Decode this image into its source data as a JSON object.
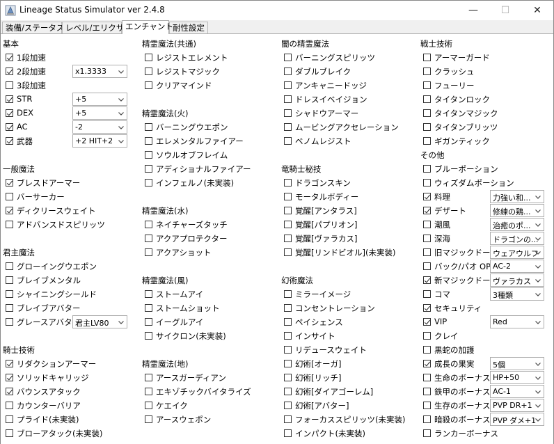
{
  "window": {
    "title": "Lineage Status Simulator ver 2.4.8",
    "minimize_glyph": "—",
    "maximize_glyph": "☐",
    "close_glyph": "✕"
  },
  "tabs": [
    {
      "label": "装備/ステータス",
      "active": false
    },
    {
      "label": "レベル/エリクサー",
      "active": false
    },
    {
      "label": "エンチャント",
      "active": true
    },
    {
      "label": "耐性設定",
      "active": false
    }
  ],
  "sections": [
    {
      "title": "基本",
      "items": [
        {
          "label": "1段加速",
          "checked": true,
          "select": null
        },
        {
          "label": "2段加速",
          "checked": true,
          "select": "x1.3333"
        },
        {
          "label": "3段加速",
          "checked": false,
          "select": null
        },
        {
          "label": "STR",
          "checked": true,
          "select": "+5"
        },
        {
          "label": "DEX",
          "checked": true,
          "select": "+5"
        },
        {
          "label": "AC",
          "checked": true,
          "select": "-2"
        },
        {
          "label": "武器",
          "checked": true,
          "select": "+2 HIT+2"
        }
      ]
    },
    {
      "title": "一般魔法",
      "items": [
        {
          "label": "ブレスドアーマー",
          "checked": true,
          "select": null
        },
        {
          "label": "バーサーカー",
          "checked": false,
          "select": null
        },
        {
          "label": "ディクリースウェイト",
          "checked": true,
          "select": null
        },
        {
          "label": "アドバンスドスピリッツ",
          "checked": false,
          "select": null
        }
      ]
    },
    {
      "title": "君主魔法",
      "items": [
        {
          "label": "グローイングウエポン",
          "checked": false,
          "select": null
        },
        {
          "label": "ブレイブメンタル",
          "checked": false,
          "select": null
        },
        {
          "label": "シャイニングシールド",
          "checked": false,
          "select": null
        },
        {
          "label": "ブレイブアバター",
          "checked": false,
          "select": null
        },
        {
          "label": "グレースアバター",
          "checked": false,
          "select": "君主LV80"
        }
      ]
    },
    {
      "title": "騎士技術",
      "items": [
        {
          "label": "リダクションアーマー",
          "checked": true,
          "select": null
        },
        {
          "label": "ソリッドキャリッジ",
          "checked": true,
          "select": null
        },
        {
          "label": "バウンスアタック",
          "checked": true,
          "select": null
        },
        {
          "label": "カウンターバリア",
          "checked": false,
          "select": null
        },
        {
          "label": "プライド(未実装)",
          "checked": false,
          "select": null
        },
        {
          "label": "ブローアタック(未実装)",
          "checked": false,
          "select": null
        }
      ]
    },
    {
      "title": "精霊魔法(共通)",
      "items": [
        {
          "label": "レジストエレメント",
          "checked": false,
          "select": null
        },
        {
          "label": "レジストマジック",
          "checked": false,
          "select": null
        },
        {
          "label": "クリアマインド",
          "checked": false,
          "select": null
        }
      ]
    },
    {
      "title": "精霊魔法(火)",
      "items": [
        {
          "label": "バーニングウエポン",
          "checked": false,
          "select": null
        },
        {
          "label": "エレメンタルファイアー",
          "checked": false,
          "select": null
        },
        {
          "label": "ソウルオブフレイム",
          "checked": false,
          "select": null
        },
        {
          "label": "アディショナルファイアー",
          "checked": false,
          "select": null
        },
        {
          "label": "インフェルノ(未実装)",
          "checked": false,
          "select": null
        }
      ]
    },
    {
      "title": "精霊魔法(水)",
      "items": [
        {
          "label": "ネイチャーズタッチ",
          "checked": false,
          "select": null
        },
        {
          "label": "アクアプロテクター",
          "checked": false,
          "select": null
        },
        {
          "label": "アクアショット",
          "checked": false,
          "select": null
        }
      ]
    },
    {
      "title": "精霊魔法(風)",
      "items": [
        {
          "label": "ストームアイ",
          "checked": false,
          "select": null
        },
        {
          "label": "ストームショット",
          "checked": false,
          "select": null
        },
        {
          "label": "イーグルアイ",
          "checked": false,
          "select": null
        },
        {
          "label": "サイクロン(未実装)",
          "checked": false,
          "select": null
        }
      ]
    },
    {
      "title": "精霊魔法(地)",
      "items": [
        {
          "label": "アースガーディアン",
          "checked": false,
          "select": null
        },
        {
          "label": "エキゾチックバイタライズ",
          "checked": false,
          "select": null
        },
        {
          "label": "ケエイク",
          "checked": false,
          "select": null
        },
        {
          "label": "アースウェポン",
          "checked": false,
          "select": null
        }
      ]
    },
    {
      "title": "闇の精霊魔法",
      "items": [
        {
          "label": "バーニングスピリッツ",
          "checked": false,
          "select": null
        },
        {
          "label": "ダブルブレイク",
          "checked": false,
          "select": null
        },
        {
          "label": "アンキャニードッジ",
          "checked": false,
          "select": null
        },
        {
          "label": "ドレスイベイジョン",
          "checked": false,
          "select": null
        },
        {
          "label": "シャドウアーマー",
          "checked": false,
          "select": null
        },
        {
          "label": "ムービングアクセレーション",
          "checked": false,
          "select": null
        },
        {
          "label": "ベノムレジスト",
          "checked": false,
          "select": null
        }
      ]
    },
    {
      "title": "竜騎士秘技",
      "items": [
        {
          "label": "ドラゴンスキン",
          "checked": false,
          "select": null
        },
        {
          "label": "モータルボディー",
          "checked": false,
          "select": null
        },
        {
          "label": "覚醒[アンタラス]",
          "checked": false,
          "select": null
        },
        {
          "label": "覚醒[パプリオン]",
          "checked": false,
          "select": null
        },
        {
          "label": "覚醒[ヴァラカス]",
          "checked": false,
          "select": null
        },
        {
          "label": "覚醒[リンドビオル](未実装)",
          "checked": false,
          "select": null
        }
      ]
    },
    {
      "title": "幻術魔法",
      "items": [
        {
          "label": "ミラーイメージ",
          "checked": false,
          "select": null
        },
        {
          "label": "コンセントレーション",
          "checked": false,
          "select": null
        },
        {
          "label": "ペイシェンス",
          "checked": false,
          "select": null
        },
        {
          "label": "インサイト",
          "checked": false,
          "select": null
        },
        {
          "label": "リデュースウェイト",
          "checked": false,
          "select": null
        },
        {
          "label": "幻術[オーガ]",
          "checked": false,
          "select": null
        },
        {
          "label": "幻術[リッチ]",
          "checked": false,
          "select": null
        },
        {
          "label": "幻術[ダイアゴーレム]",
          "checked": false,
          "select": null
        },
        {
          "label": "幻術[アバター]",
          "checked": false,
          "select": null
        },
        {
          "label": "フォーカススピリッツ(未実装)",
          "checked": false,
          "select": null
        },
        {
          "label": "インパクト(未実装)",
          "checked": false,
          "select": null
        }
      ]
    },
    {
      "title": "戦士技術",
      "items": [
        {
          "label": "アーマーガード",
          "checked": false,
          "select": null
        },
        {
          "label": "クラッシュ",
          "checked": false,
          "select": null
        },
        {
          "label": "フューリー",
          "checked": false,
          "select": null
        },
        {
          "label": "タイタンロック",
          "checked": false,
          "select": null
        },
        {
          "label": "タイタンマジック",
          "checked": false,
          "select": null
        },
        {
          "label": "タイタンブリッツ",
          "checked": false,
          "select": null
        },
        {
          "label": "ギガンティック",
          "checked": false,
          "select": null
        }
      ]
    },
    {
      "title": "その他",
      "items": [
        {
          "label": "ブルーポーション",
          "checked": false,
          "select": null
        },
        {
          "label": "ウィズダムポーション",
          "checked": false,
          "select": null
        },
        {
          "label": "料理",
          "checked": true,
          "select": "力強い和..."
        },
        {
          "label": "デザート",
          "checked": true,
          "select": "修練の鶏..."
        },
        {
          "label": "潮風",
          "checked": false,
          "select": "治癒のポ..."
        },
        {
          "label": "深海",
          "checked": false,
          "select": "ドラゴンの..."
        },
        {
          "label": "旧マジックドール",
          "checked": false,
          "select": "ウェアウルフ"
        },
        {
          "label": "バック/パオ OP",
          "checked": false,
          "select": "AC-2"
        },
        {
          "label": "新マジックドール",
          "checked": true,
          "select": "ヴァラカス"
        },
        {
          "label": "コマ",
          "checked": false,
          "select": "3種類"
        },
        {
          "label": "セキュリティ",
          "checked": true,
          "select": null
        },
        {
          "label": "VIP",
          "checked": true,
          "select": "Red"
        },
        {
          "label": "クレイ",
          "checked": false,
          "select": null
        },
        {
          "label": "黒蛇の加護",
          "checked": false,
          "select": null
        },
        {
          "label": "成長の果実",
          "checked": true,
          "select": "5個"
        },
        {
          "label": "生命のボーナス",
          "checked": false,
          "select": "HP+50"
        },
        {
          "label": "鉄甲のボーナス",
          "checked": false,
          "select": "AC-1"
        },
        {
          "label": "生存のボーナス",
          "checked": false,
          "select": "PVP DR+1"
        },
        {
          "label": "暗殺のボーナス",
          "checked": false,
          "select": "PVP ダメ+1"
        },
        {
          "label": "ランカーボーナス",
          "checked": false,
          "select": null
        }
      ]
    }
  ]
}
